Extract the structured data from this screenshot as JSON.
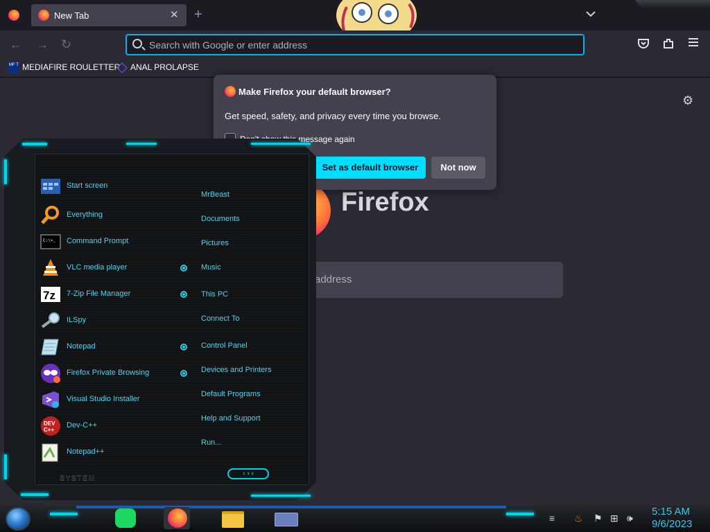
{
  "browser": {
    "tab_title": "New Tab",
    "tab_close": "✕",
    "new_tab": "+",
    "list_tabs": "⌄",
    "url_placeholder": "Search with Google or enter address"
  },
  "bookmarks": [
    {
      "label": "MEDIAFIRE ROULETTER",
      "icon": "mediafire-icon",
      "icon_text": "MF T"
    },
    {
      "label": "ANAL PROLAPSE",
      "icon": "bookmark-generic-icon"
    }
  ],
  "newtab": {
    "wordmark": "Firefox",
    "search_placeholder": "address"
  },
  "default_browser_panel": {
    "title": "Make Firefox your default browser?",
    "body": "Get speed, safety, and privacy every time you browse.",
    "checkbox_label": "Don't show this message again",
    "primary_button": "Set as default browser",
    "secondary_button": "Not now"
  },
  "start_menu": {
    "programs": [
      {
        "label": "Start screen",
        "icon": "start-screen-icon"
      },
      {
        "label": "Everything",
        "icon": "everything-search-icon"
      },
      {
        "label": "Command Prompt",
        "icon": "cmd-icon"
      },
      {
        "label": "VLC media player",
        "icon": "vlc-icon"
      },
      {
        "label": "7-Zip File Manager",
        "icon": "7zip-icon"
      },
      {
        "label": "ILSpy",
        "icon": "ilspy-icon"
      },
      {
        "label": "Notepad",
        "icon": "notepad-icon"
      },
      {
        "label": "Firefox Private Browsing",
        "icon": "firefox-private-icon"
      },
      {
        "label": "Visual Studio Installer",
        "icon": "vs-installer-icon"
      },
      {
        "label": "Dev-C++",
        "icon": "devcpp-icon"
      },
      {
        "label": "Notepad++",
        "icon": "notepadpp-icon"
      }
    ],
    "places": [
      {
        "label": "MrBeast",
        "expandable": false
      },
      {
        "label": "Documents",
        "expandable": false
      },
      {
        "label": "Pictures",
        "expandable": false
      },
      {
        "label": "Music",
        "expandable": true
      },
      {
        "label": "This PC",
        "expandable": true
      },
      {
        "label": "Connect To",
        "expandable": false
      },
      {
        "label": "Control Panel",
        "expandable": true
      },
      {
        "label": "Devices and Printers",
        "expandable": true
      },
      {
        "label": "Default Programs",
        "expandable": false
      },
      {
        "label": "Help and Support",
        "expandable": false
      },
      {
        "label": "Run...",
        "expandable": false
      }
    ],
    "system_label": "SYSTEM",
    "nav_arrows": "‹ › ›"
  },
  "taskbar": {
    "time": "5:15 AM",
    "date": "9/6/2023",
    "pinned": [
      "spotify-icon",
      "firefox-icon",
      "file-explorer-icon",
      "app-icon"
    ],
    "tray": [
      "show-hidden-icon",
      "java-icon",
      "flag-icon",
      "network-icon",
      "volume-icon"
    ]
  },
  "colors": {
    "accent_cyan": "#00ddff",
    "menu_text": "#4fd4f0",
    "browser_bg": "#2b2a33",
    "tabbar_bg": "#1c1b22"
  }
}
